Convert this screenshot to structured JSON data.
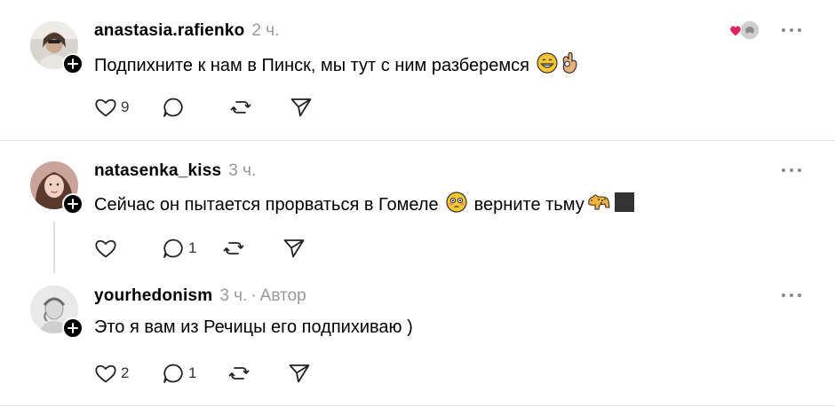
{
  "posts": [
    {
      "username": "anastasia.rafienko",
      "time": "2 ч.",
      "text": "Подпихните к нам в Пинск, мы тут с ним разберемся",
      "emojis": [
        "grinning-face-icon",
        "ok-hand-icon"
      ],
      "likes": "9",
      "replies": "",
      "liked_by_indicator": "heart-avatar-icon"
    },
    {
      "username": "natasenka_kiss",
      "time": "3 ч.",
      "text": "Сейчас он пытается прорваться в Гомеле",
      "text_after": "верните тьму",
      "emojis": [
        "flushed-face-icon",
        "leopard-icon",
        "black-square-icon"
      ],
      "likes": "",
      "replies": "1"
    },
    {
      "username": "yourhedonism",
      "time": "3 ч.",
      "author_tag": "Автор",
      "text": "Это я вам из Речицы его подпихиваю )",
      "likes": "2",
      "replies": "1"
    }
  ],
  "colors": {
    "text": "#000000",
    "muted": "#999999",
    "divider": "#e5e5e5",
    "like_red": "#e0245e"
  }
}
